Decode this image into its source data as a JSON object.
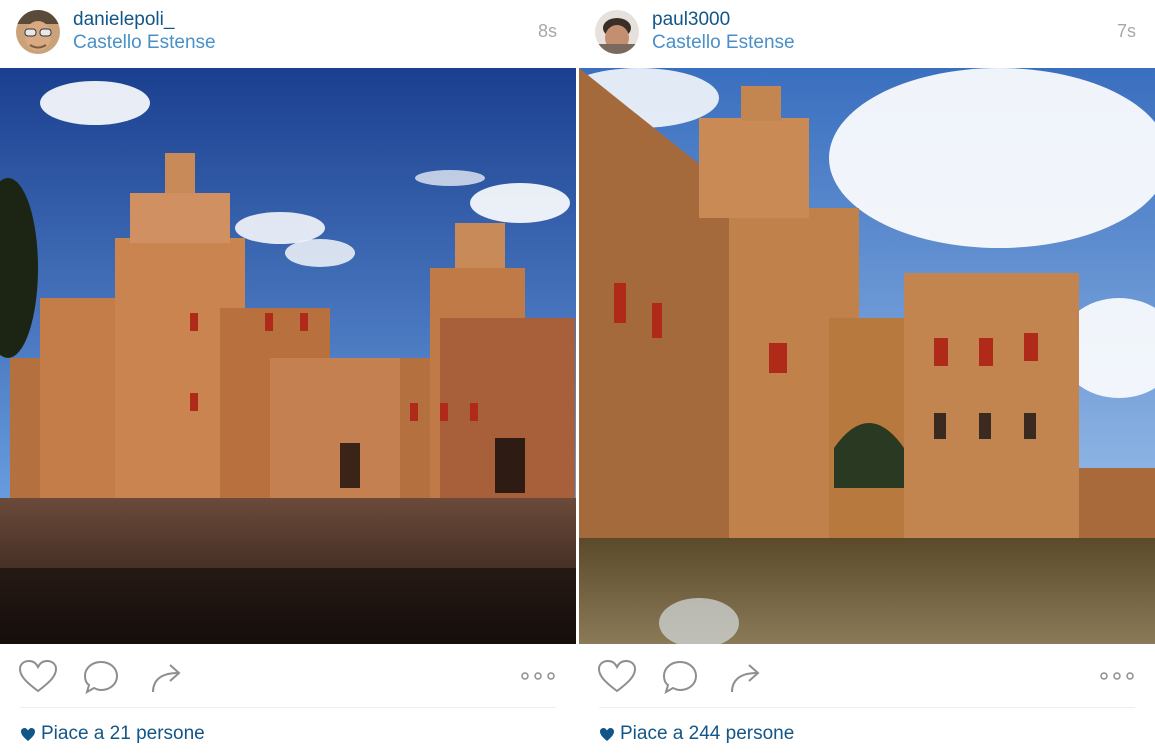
{
  "posts": [
    {
      "username": "danielepoli_",
      "location": "Castello Estense",
      "time": "8s",
      "likes_text": "Piace a 21 persone",
      "photo_desc": "castle-photo"
    },
    {
      "username": "paul3000",
      "location": "Castello Estense",
      "time": "7s",
      "likes_text": "Piace a 244 persone",
      "photo_desc": "castle-moat-photo"
    }
  ],
  "icons": {
    "like": "heart-icon",
    "comment": "comment-bubble-icon",
    "share": "share-arrow-icon",
    "more": "more-options-icon",
    "likes": "small-heart-icon"
  },
  "colors": {
    "username": "#125688",
    "location": "#4a90c8",
    "timestamp": "#a8a8a8",
    "icon": "#8e8e8e"
  }
}
